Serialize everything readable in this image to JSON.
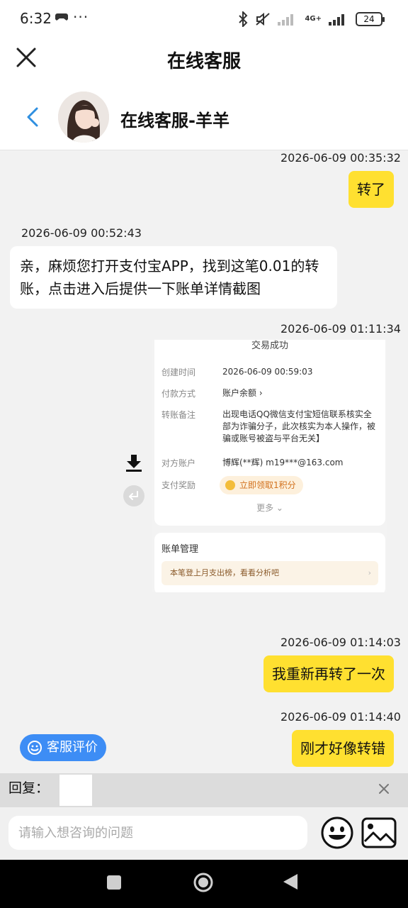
{
  "status_bar": {
    "time": "6:32",
    "dots": "···",
    "network": "4G+",
    "battery": "24"
  },
  "header": {
    "title": "在线客服"
  },
  "agent": {
    "name": "在线客服-羊羊"
  },
  "messages": [
    {
      "from": "user",
      "timestamp": "2026-06-09 00:35:32",
      "text": "转了"
    },
    {
      "from": "agent",
      "timestamp": "2026-06-09 00:52:43",
      "lines": [
        "亲，麻烦您打开支付宝APP，找到这笔0.01的转",
        "账，点击进入后提供一下账单详情截图"
      ]
    },
    {
      "from": "user",
      "timestamp": "2026-06-09 01:11:34",
      "image": {
        "title": "交易成功",
        "rows": [
          {
            "label": "创建时间",
            "value": "2026-06-09 00:59:03"
          },
          {
            "label": "付款方式",
            "value": "账户余额 ›"
          },
          {
            "label": "转账备注",
            "value": "出现电话QQ微信支付宝短信联系核实全部为诈骗分子，此次核实为本人操作，被骗或账号被盗与平台无关】"
          },
          {
            "label": "对方账户",
            "value": "博辉(**辉) m19***@163.com"
          },
          {
            "label": "支付奖励",
            "value": "立即领取1积分"
          }
        ],
        "more": "更多 ⌄",
        "section_title": "账单管理",
        "section_row": "本笔登上月支出榜，看看分析吧"
      }
    },
    {
      "from": "user",
      "timestamp": "2026-06-09 01:14:03",
      "text": "我重新再转了一次"
    },
    {
      "from": "user",
      "timestamp": "2026-06-09 01:14:40",
      "text": "刚才好像转错"
    }
  ],
  "rate_button": {
    "label": "客服评价"
  },
  "reply": {
    "label": "回复："
  },
  "input": {
    "placeholder": "请输入想咨询的问题"
  },
  "icons": [
    "close-icon",
    "back-icon",
    "download-icon",
    "forward-icon",
    "smile-icon",
    "emoji-icon",
    "image-icon",
    "reply-close-icon"
  ]
}
